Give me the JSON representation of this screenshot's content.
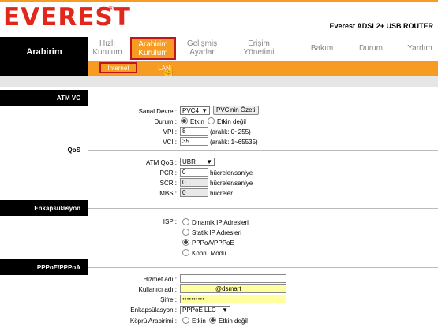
{
  "brand": {
    "logo_text": "EVEREST",
    "registered": "®",
    "product": "Everest ADSL2+ USB ROUTER"
  },
  "nav": {
    "section_title": "Arabirim",
    "items": [
      {
        "line1": "Hızlı",
        "line2": "Kurulum"
      },
      {
        "line1": "Arabirim",
        "line2": "Kurulum"
      },
      {
        "line1": "Gelişmiş",
        "line2": "Ayarlar"
      },
      {
        "line1": "Erişim",
        "line2": "Yönetimi"
      },
      {
        "line1": "Bakım",
        "line2": ""
      },
      {
        "line1": "Durum",
        "line2": ""
      },
      {
        "line1": "Yardım",
        "line2": ""
      }
    ],
    "sub_items": [
      "Internet",
      "LAN"
    ]
  },
  "atm": {
    "section": "ATM VC",
    "sanal_devre_label": "Sanal Devre :",
    "sanal_devre_value": "PVC4",
    "pvc_ozet_button": "PVC'nin Özeti",
    "durum_label": "Durum :",
    "etkin": "Etkin",
    "etkin_degil": "Etkin değil",
    "vpi_label": "VPI :",
    "vpi_value": "8",
    "vpi_hint": "(aralık: 0~255)",
    "vci_label": "VCI :",
    "vci_value": "35",
    "vci_hint": "(aralık: 1~65535)"
  },
  "qos": {
    "section": "QoS",
    "atm_qos_label": "ATM QoS :",
    "atm_qos_value": "UBR",
    "pcr_label": "PCR :",
    "pcr_value": "0",
    "scr_label": "SCR :",
    "scr_value": "0",
    "mbs_label": "MBS :",
    "mbs_value": "0",
    "unit_cells": "hücreler/saniye",
    "unit_cells_plain": "hücreler"
  },
  "encap": {
    "section": "Enkapsülasyon",
    "isp_label": "ISP :",
    "options": [
      "Dinamik IP Adresleri",
      "Statik IP Adresleri",
      "PPPoA/PPPoE",
      "Köprü Modu"
    ],
    "selected_index": 2
  },
  "pppoe": {
    "section": "PPPoE/PPPoA",
    "hizmet_label": "Hizmet adı :",
    "hizmet_value": "",
    "kullanici_label": "Kullanıcı adı :",
    "kullanici_value": "@dsmart",
    "sifre_label": "Şifre :",
    "sifre_value": "••••••••••",
    "enkap_label": "Enkapsülasyon :",
    "enkap_value": "PPPoE LLC",
    "kopru_label": "Köprü Arabirimi :",
    "etkin": "Etkin",
    "etkin_degil": "Etkin değil"
  },
  "colors": {
    "accent": "#f79c23",
    "logo_red": "#e3261b",
    "active_border": "#c0151b"
  }
}
